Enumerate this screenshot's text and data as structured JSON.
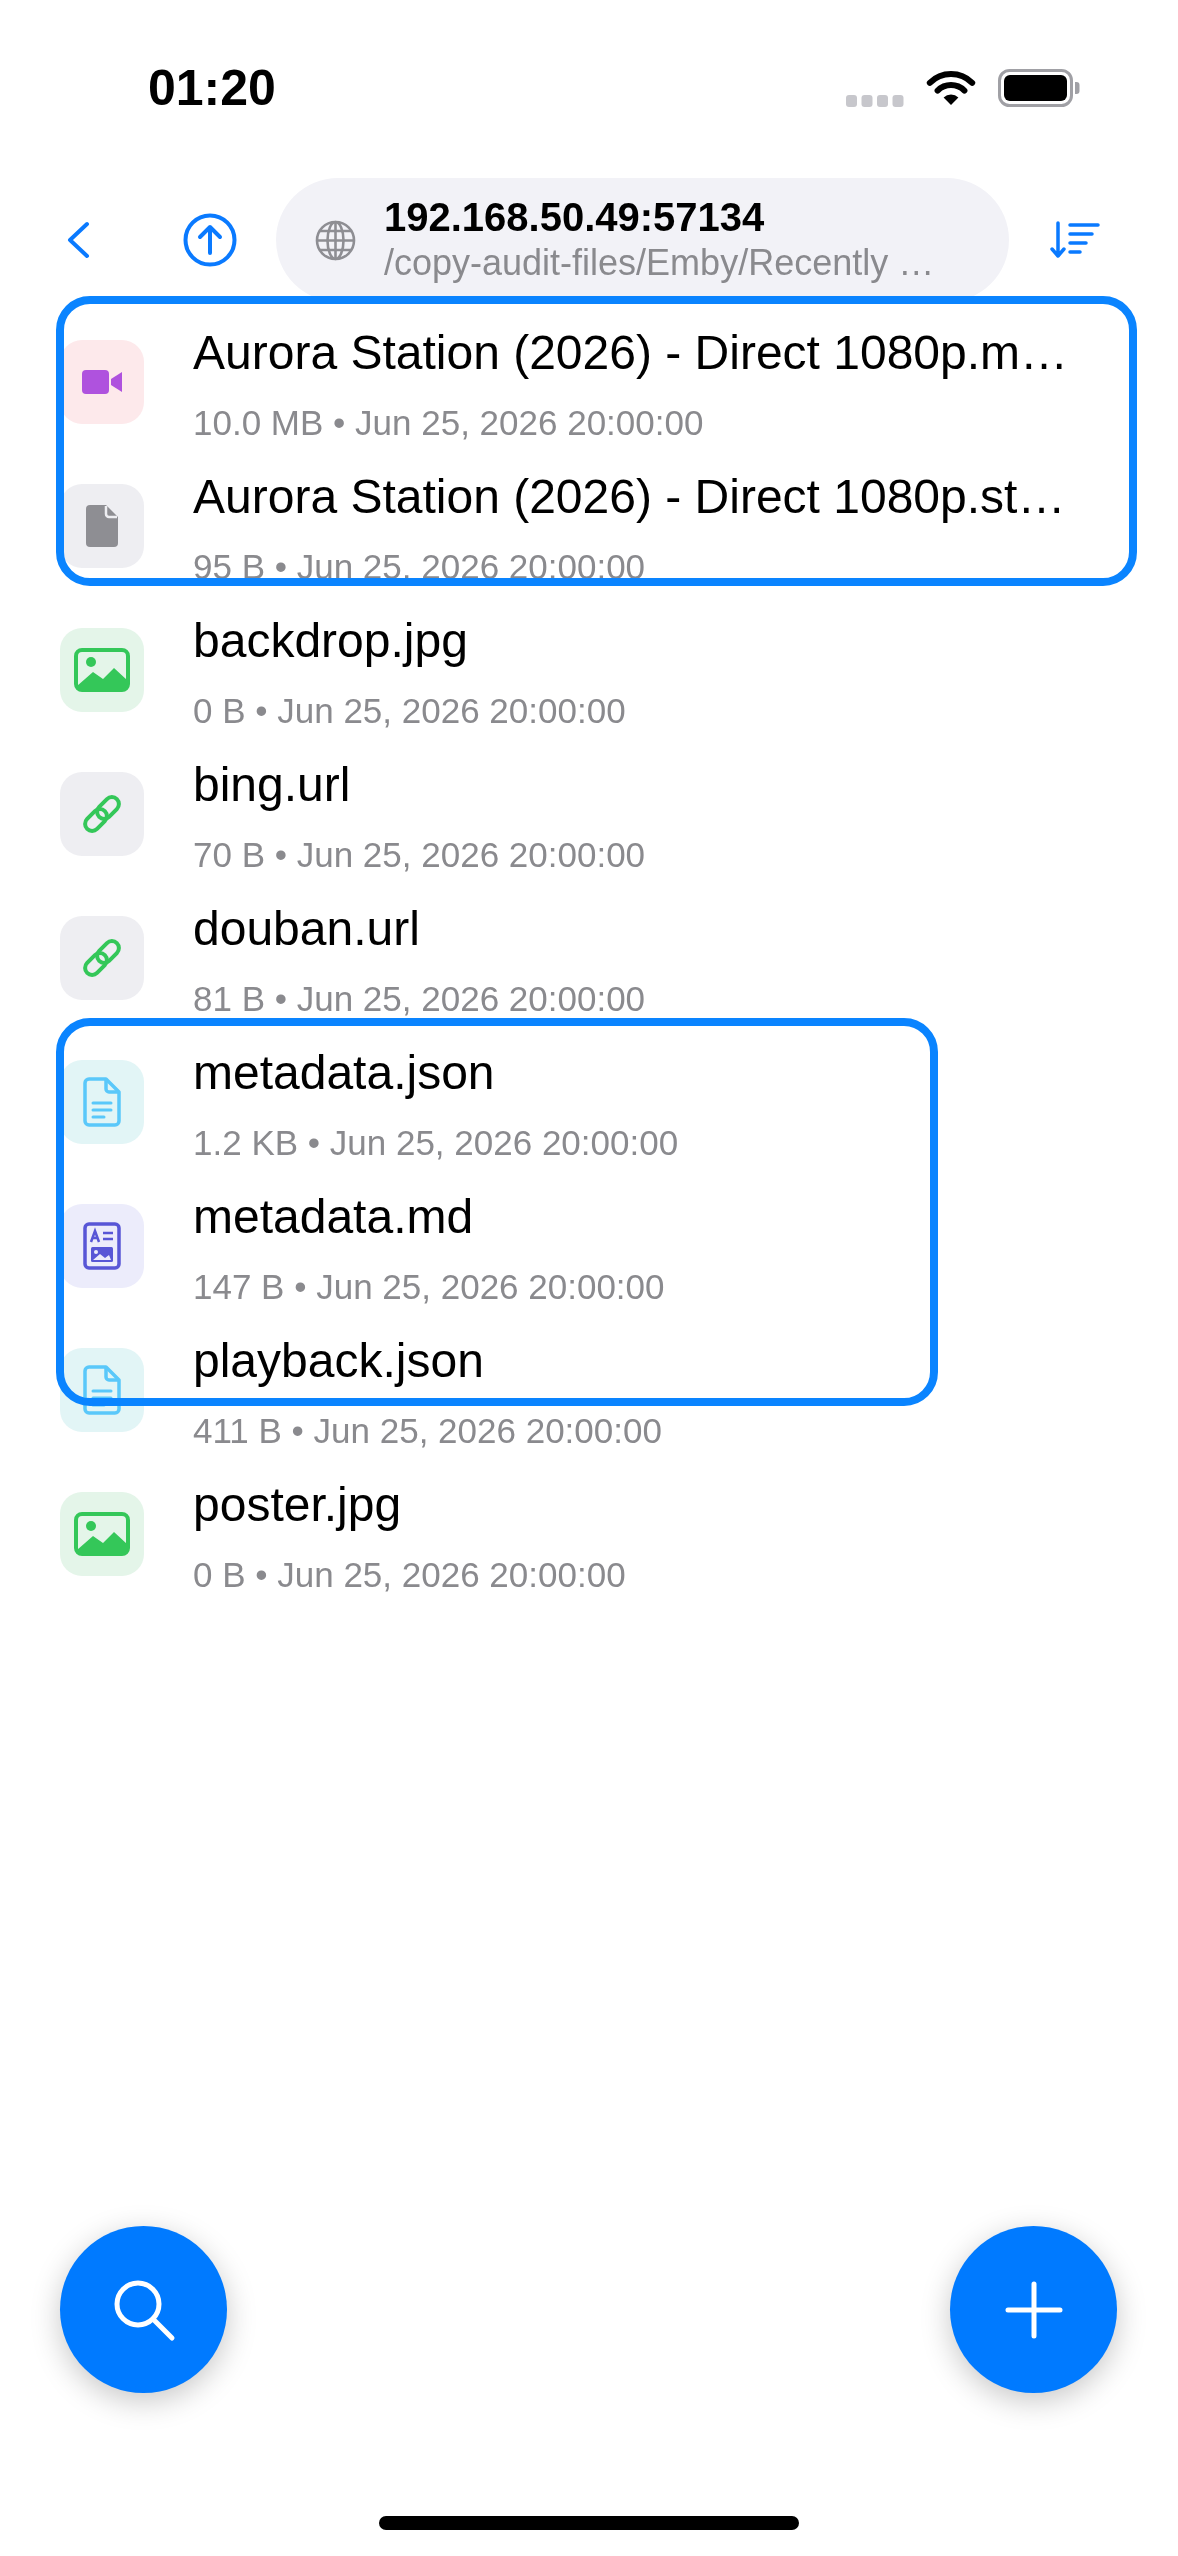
{
  "status_bar": {
    "time": "01:20"
  },
  "toolbar": {
    "server": "192.168.50.49:57134",
    "path": "/copy-audit-files/Emby/Recently …"
  },
  "files": [
    {
      "kind": "video",
      "name": "Aurora Station (2026) - Direct 1080p.m…",
      "details": "10.0 MB • Jun 25, 2026 20:00:00",
      "selected": true
    },
    {
      "kind": "file",
      "name": "Aurora Station (2026) - Direct 1080p.st…",
      "details": "95 B • Jun 25, 2026 20:00:00",
      "selected": true
    },
    {
      "kind": "image",
      "name": "backdrop.jpg",
      "details": "0 B • Jun 25, 2026 20:00:00",
      "selected": false
    },
    {
      "kind": "link",
      "name": "bing.url",
      "details": "70 B • Jun 25, 2026 20:00:00",
      "selected": false
    },
    {
      "kind": "link",
      "name": "douban.url",
      "details": "81 B • Jun 25, 2026 20:00:00",
      "selected": false
    },
    {
      "kind": "json",
      "name": "metadata.json",
      "details": "1.2 KB • Jun 25, 2026 20:00:00",
      "selected": true
    },
    {
      "kind": "markdown",
      "name": "metadata.md",
      "details": "147 B • Jun 25, 2026 20:00:00",
      "selected": true
    },
    {
      "kind": "json",
      "name": "playback.json",
      "details": "411 B • Jun 25, 2026 20:00:00",
      "selected": true
    },
    {
      "kind": "image",
      "name": "poster.jpg",
      "details": "0 B • Jun 25, 2026 20:00:00",
      "selected": false
    }
  ]
}
